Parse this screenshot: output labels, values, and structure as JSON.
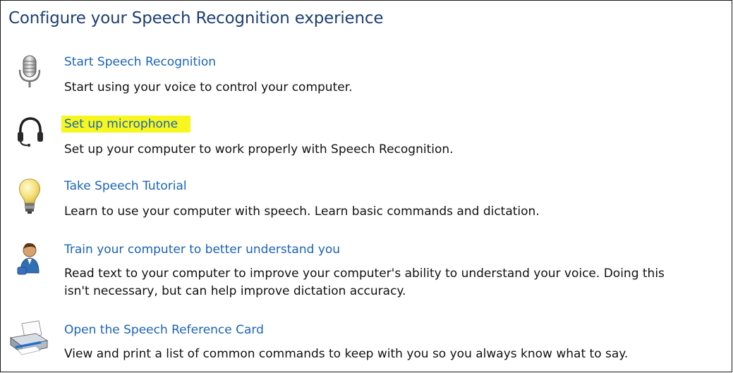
{
  "page": {
    "title": "Configure your Speech Recognition experience"
  },
  "items": [
    {
      "icon": "microphone-icon",
      "link": "Start Speech Recognition",
      "desc_lines": [
        "Start using your voice to control your computer."
      ]
    },
    {
      "icon": "headset-icon",
      "link": "Set up microphone",
      "desc_lines": [
        "Set up your computer to work properly with Speech Recognition."
      ]
    },
    {
      "icon": "lightbulb-icon",
      "link": "Take Speech Tutorial",
      "desc_lines": [
        "Learn to use your computer with speech.  Learn basic commands and dictation."
      ]
    },
    {
      "icon": "user-training-icon",
      "link": "Train your computer to better understand you",
      "desc_lines": [
        "Read text to your computer to improve your computer's ability to understand your voice.  Doing this",
        "isn't necessary, but can help improve dictation accuracy."
      ]
    },
    {
      "icon": "printer-icon",
      "link": "Open the Speech Reference Card",
      "desc_lines": [
        "View and print a list of common commands to keep with you so you always know what to say."
      ]
    }
  ],
  "colors": {
    "title": "#1e3f73",
    "link": "#1a63b8",
    "highlight": "#f7f71f"
  }
}
